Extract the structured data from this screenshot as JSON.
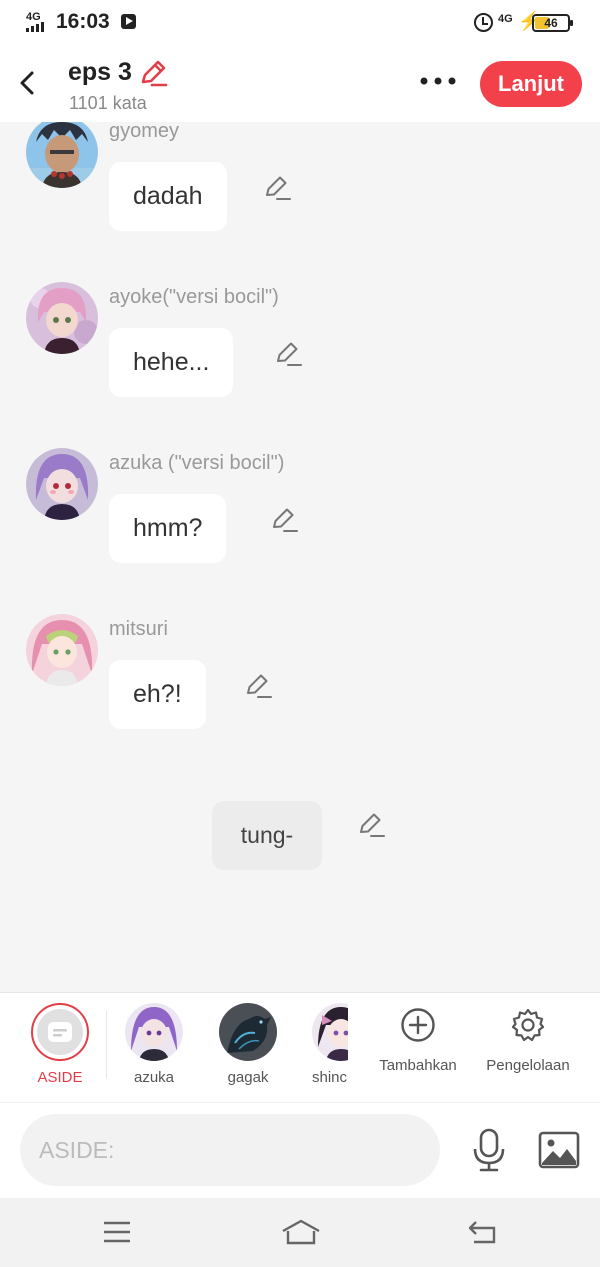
{
  "status_bar": {
    "signal_label": "4G",
    "time": "16:03",
    "network": "4G",
    "battery": "46"
  },
  "header": {
    "title": "eps 3",
    "word_count": "1101 kata",
    "continue_button": "Lanjut"
  },
  "messages": [
    {
      "speaker": "gyomey",
      "text": "dadah"
    },
    {
      "speaker": "ayoke(\"versi bocil\")",
      "text": "hehe..."
    },
    {
      "speaker": "azuka (\"versi bocil\")",
      "text": "hmm?"
    },
    {
      "speaker": "mitsuri",
      "text": "eh?!"
    }
  ],
  "aside_message": {
    "text": "tung-"
  },
  "character_tray": {
    "aside": "ASIDE",
    "characters": [
      "azuka",
      "gagak",
      "shinc"
    ],
    "add_label": "Tambahkan",
    "manage_label": "Pengelolaan"
  },
  "input": {
    "placeholder": "ASIDE:"
  },
  "colors": {
    "accent": "#f2414a",
    "background": "#f5f5f5",
    "bubble": "#ffffff",
    "aside_bubble": "#ececec"
  }
}
